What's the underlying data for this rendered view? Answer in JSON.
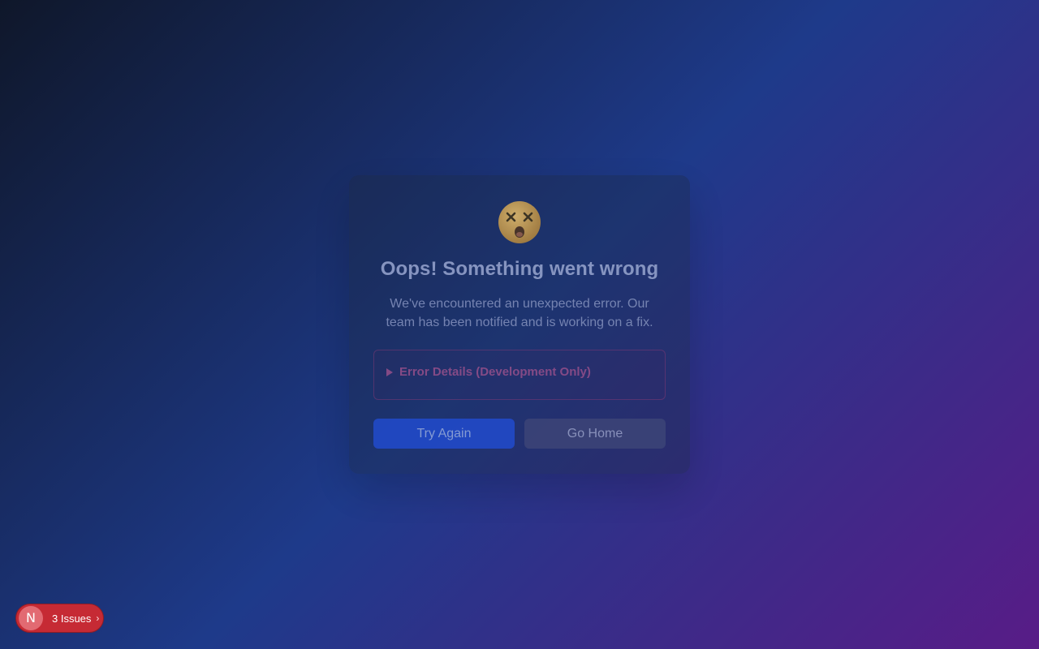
{
  "error_card": {
    "emoji_icon": "dizzy-face-icon",
    "title": "Oops! Something went wrong",
    "message": "We've encountered an unexpected error. Our team has been notified and is working on a fix.",
    "details_summary": "Error Details (Development Only)",
    "try_again_label": "Try Again",
    "go_home_label": "Go Home"
  },
  "dev_overlay": {
    "logo_letter": "N",
    "issues_label": "3 Issues",
    "chevron_icon": "chevron-right-icon"
  },
  "colors": {
    "background_start": "#0f172a",
    "background_mid": "#1e3a8a",
    "background_end": "#581c87",
    "primary_button": "#2148c2",
    "secondary_button": "#3a4275",
    "issues_badge": "#c62a34"
  }
}
